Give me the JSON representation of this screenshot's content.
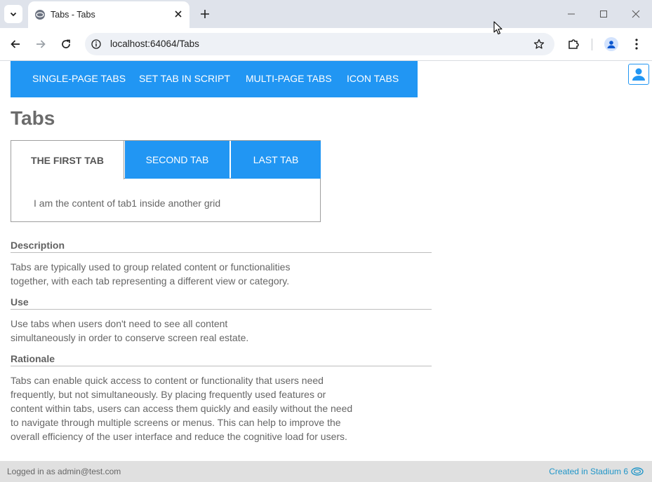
{
  "browser": {
    "tab_title": "Tabs - Tabs",
    "url": "localhost:64064/Tabs",
    "icons": [
      "tab-search-icon",
      "favicon",
      "close-icon",
      "plus-icon",
      "minimize-icon",
      "maximize-icon",
      "window-close-icon",
      "back-icon",
      "forward-icon",
      "reload-icon",
      "site-info-icon",
      "star-icon",
      "extensions-icon",
      "profile-icon",
      "more-icon"
    ]
  },
  "nav": {
    "items": [
      "SINGLE-PAGE TABS",
      "SET TAB IN SCRIPT",
      "MULTI-PAGE TABS",
      "ICON TABS"
    ],
    "accent": "#2196f3"
  },
  "page": {
    "title": "Tabs"
  },
  "tabs_demo": {
    "tabs": [
      "THE FIRST TAB",
      "SECOND TAB",
      "LAST TAB"
    ],
    "active_tab": "THE FIRST TAB",
    "content": "I am the content of tab1 inside another grid"
  },
  "sections": [
    {
      "heading": "Description",
      "lines": [
        "Tabs are typically used to group related content or functionalities",
        "together, with each tab representing a different view or category."
      ]
    },
    {
      "heading": "Use",
      "lines": [
        "Use tabs when users don't need to see all content",
        "simultaneously in order to conserve screen real estate."
      ]
    },
    {
      "heading": "Rationale",
      "lines": [
        "Tabs can enable quick access to content or functionality that users need",
        "frequently, but not simultaneously. By placing frequently used features or",
        "content within tabs, users can access them quickly and easily without the need",
        "to navigate through multiple screens or menus. This can help to improve the",
        "overall efficiency of the user interface and reduce the cognitive load for users."
      ]
    }
  ],
  "status": {
    "logged_in": "Logged in as admin@test.com",
    "created": "Created in Stadium 6"
  }
}
